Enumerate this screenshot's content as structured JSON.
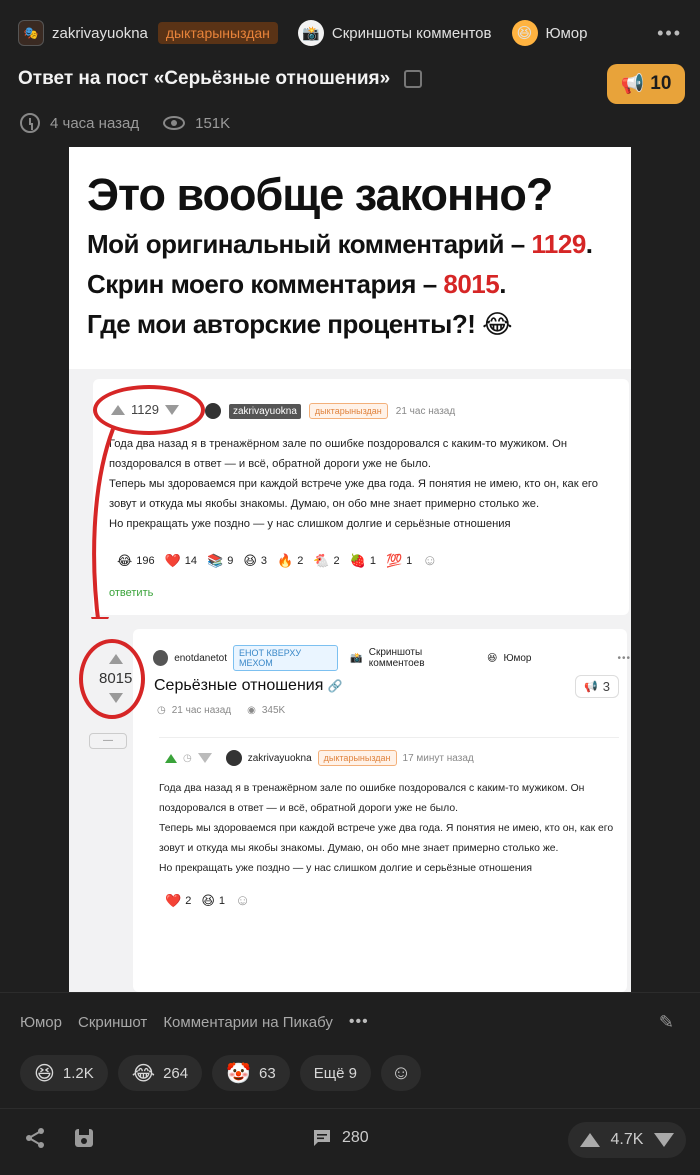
{
  "header": {
    "author": "zakrivayuokna",
    "author_tag": "дыктарыныздан",
    "community": "Скриншоты комментов",
    "community2": "Юмор"
  },
  "post": {
    "title": "Ответ на пост «Серьёзные отношения»",
    "rating": "10",
    "time": "4 часа назад",
    "views": "151K"
  },
  "image": {
    "headline": "Это вообще законно?",
    "line1_text": "Мой оригинальный комментарий – ",
    "line1_num": "1129",
    "line1_end": ".",
    "line2_text": "Скрин моего комментария – ",
    "line2_num": "8015",
    "line2_end": ".",
    "line3_text": "Где мои авторские проценты?!",
    "line3_emoji": "😂",
    "c1": {
      "votes": "1129",
      "user": "zakrivayuokna",
      "tag": "дыктарыныздан",
      "time": "21 час назад",
      "lines": [
        "Года два назад я в тренажёрном зале по ошибке поздоровался с каким-то мужиком. Он",
        "поздоровался в ответ — и всё, обратной дороги уже не было.",
        "Теперь мы здороваемся при каждой встрече уже два года. Я понятия не имею, кто он, как его",
        "зовут и откуда мы якобы знакомы. Думаю, он обо мне знает примерно столько же.",
        "Но прекращать уже поздно — у нас слишком долгие и серьёзные отношения"
      ],
      "reactions": [
        {
          "e": "😂",
          "n": "196"
        },
        {
          "e": "❤️",
          "n": "14"
        },
        {
          "e": "📚",
          "n": "9"
        },
        {
          "e": "😆",
          "n": "3"
        },
        {
          "e": "🔥",
          "n": "2"
        },
        {
          "e": "🐔",
          "n": "2"
        },
        {
          "e": "🍓",
          "n": "1"
        },
        {
          "e": "💯",
          "n": "1"
        }
      ],
      "reply": "ответить"
    },
    "c2": {
      "votes": "8015",
      "user": "enotdanetot",
      "tag": "ЕНОТ КВЕРХУ МЕХОМ",
      "community": "Скриншоты комментоев",
      "community2": "Юмор",
      "title": "Серьёзные отношения",
      "count": "3",
      "time": "21 час назад",
      "views": "345K",
      "minus": "—"
    },
    "c3": {
      "user": "zakrivayuokna",
      "tag": "дыктарыныздан",
      "time": "17 минут назад",
      "lines": [
        "Года два назад я в тренажёрном зале по ошибке поздоровался с каким-то мужиком. Он",
        "поздоровался в ответ — и всё, обратной дороги уже не было.",
        "Теперь мы здороваемся при каждой встрече уже два года. Я понятия не имею, кто он, как его",
        "зовут и откуда мы якобы знакомы. Думаю, он обо мне знает примерно столько же.",
        "Но прекращать уже поздно — у нас слишком долгие и серьёзные отношения"
      ],
      "reactions": [
        {
          "e": "❤️",
          "n": "2"
        },
        {
          "e": "😆",
          "n": "1"
        }
      ]
    }
  },
  "tags": [
    "Юмор",
    "Скриншот",
    "Комментарии на Пикабу"
  ],
  "reactions": [
    {
      "icon": "laughing-face",
      "e": "😆",
      "n": "1.2K"
    },
    {
      "icon": "tears-of-joy",
      "e": "😂",
      "n": "264"
    },
    {
      "icon": "clown-face",
      "e": "🤡",
      "n": "63"
    }
  ],
  "more_reactions": "Ещё 9",
  "footer": {
    "comments": "280",
    "votes": "4.7K"
  },
  "colors": {
    "accent": "#e8a33a",
    "bg": "#1f1f1f",
    "highlight_red": "#d62626"
  }
}
